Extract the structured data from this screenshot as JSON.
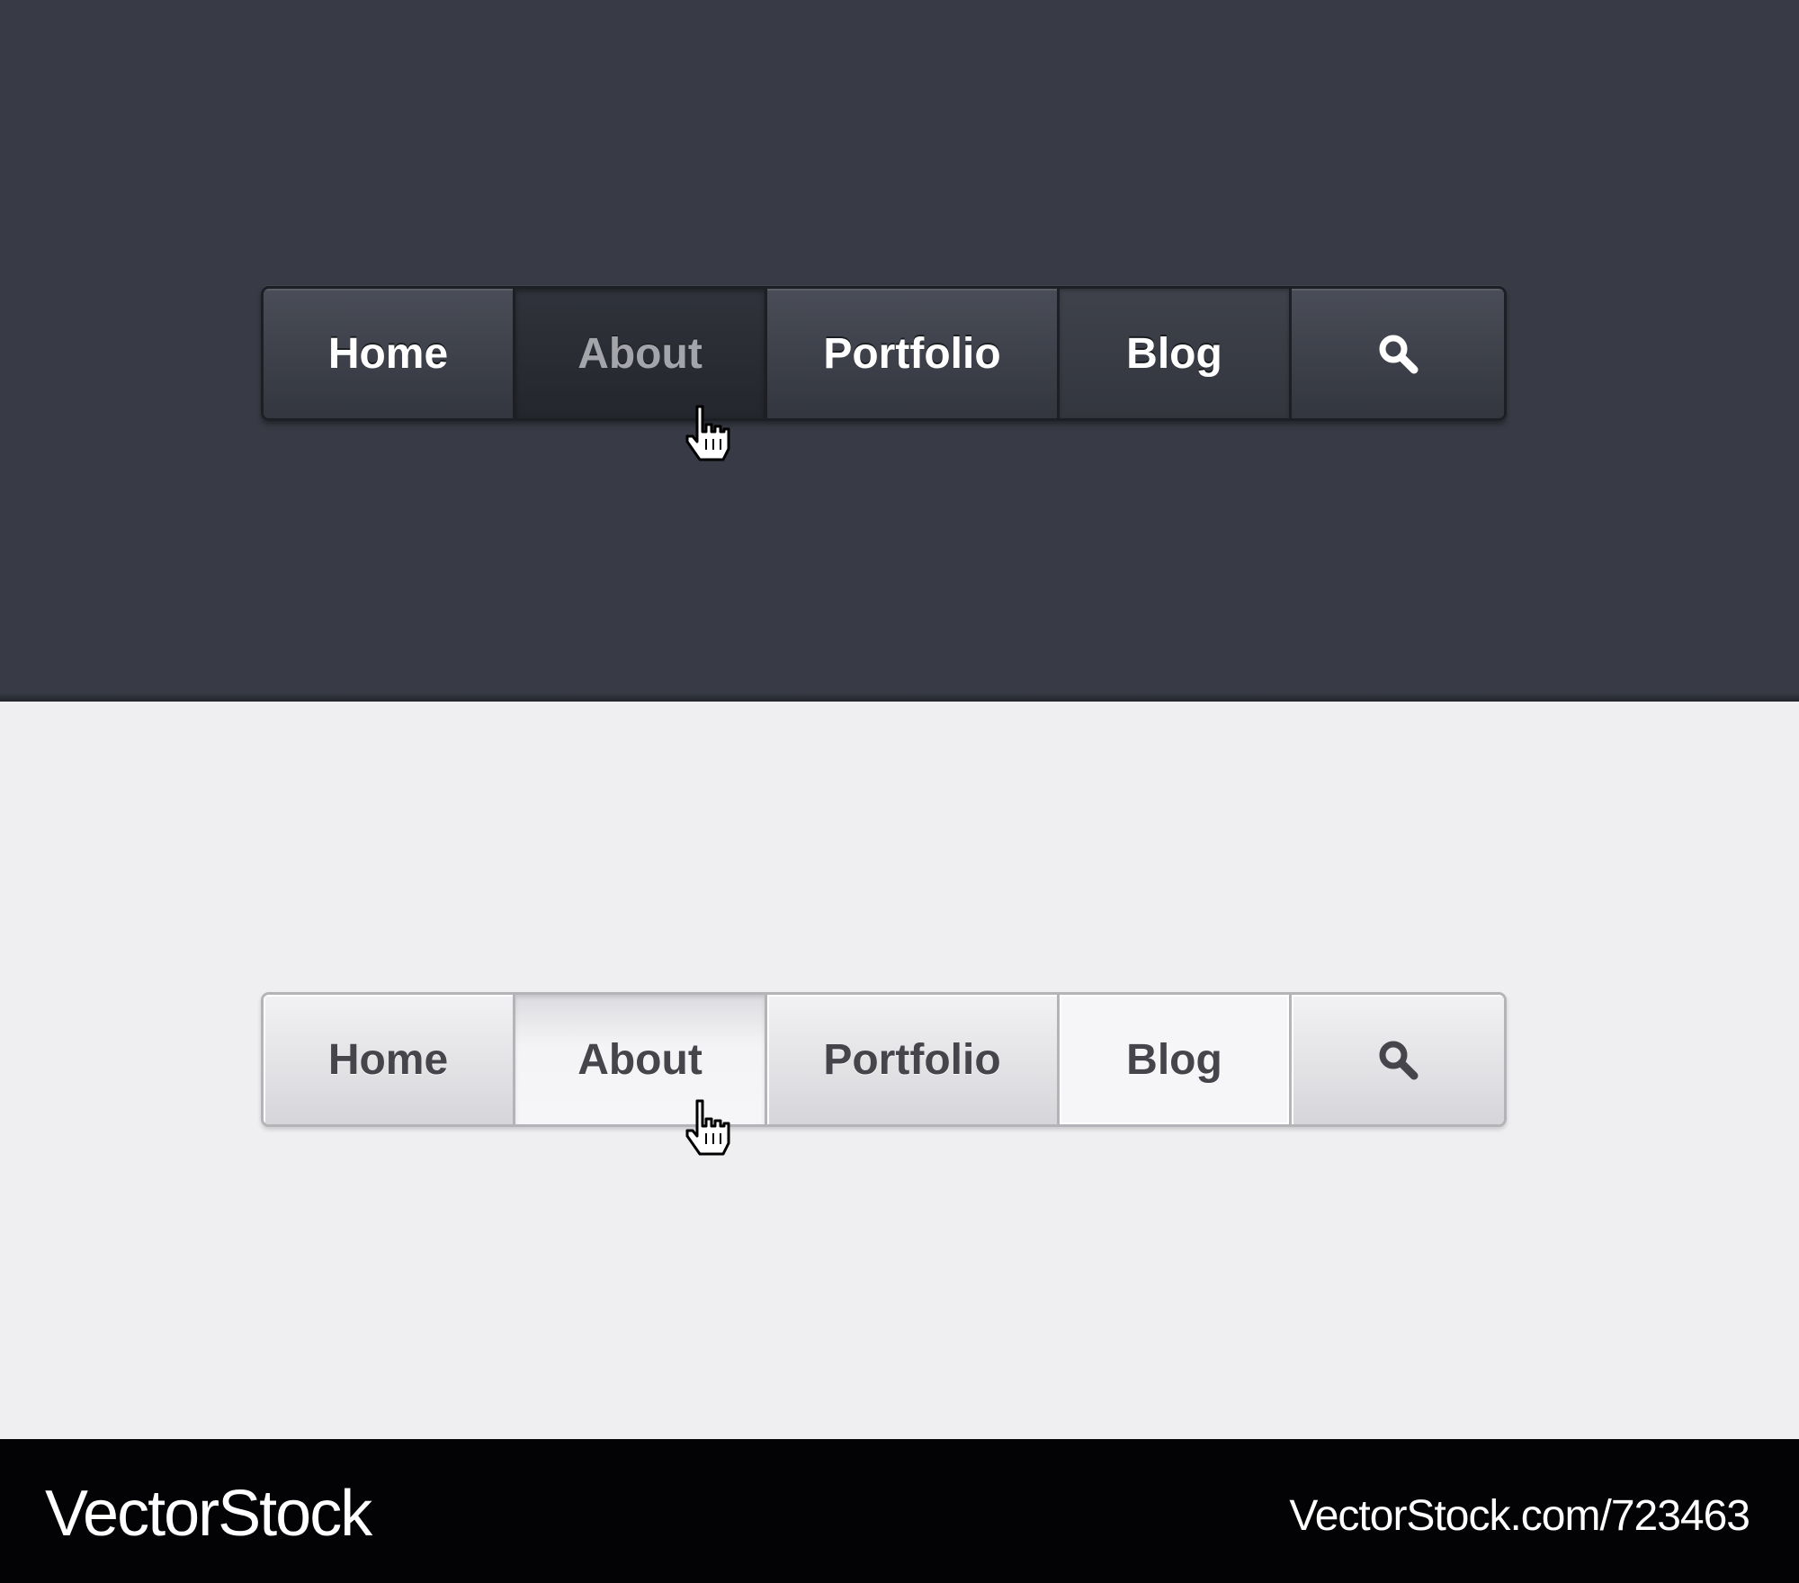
{
  "dark_nav": {
    "items": [
      {
        "label": "Home"
      },
      {
        "label": "About"
      },
      {
        "label": "Portfolio"
      },
      {
        "label": "Blog"
      }
    ],
    "search_icon": "search-icon",
    "active_item": "About",
    "hovered_item": "Blog"
  },
  "light_nav": {
    "items": [
      {
        "label": "Home"
      },
      {
        "label": "About"
      },
      {
        "label": "Portfolio"
      },
      {
        "label": "Blog"
      }
    ],
    "search_icon": "search-icon",
    "active_item": "About",
    "hovered_item": "Blog"
  },
  "cursor_icon": "hand-pointer-icon",
  "footer": {
    "brand": "VectorStock",
    "reference": "VectorStock.com/723463"
  },
  "colors": {
    "dark_background": "#383b45",
    "light_background": "#efeef0",
    "footer_background": "#030305",
    "dark_active_text": "#a3a5ab",
    "light_text": "#45454b"
  }
}
